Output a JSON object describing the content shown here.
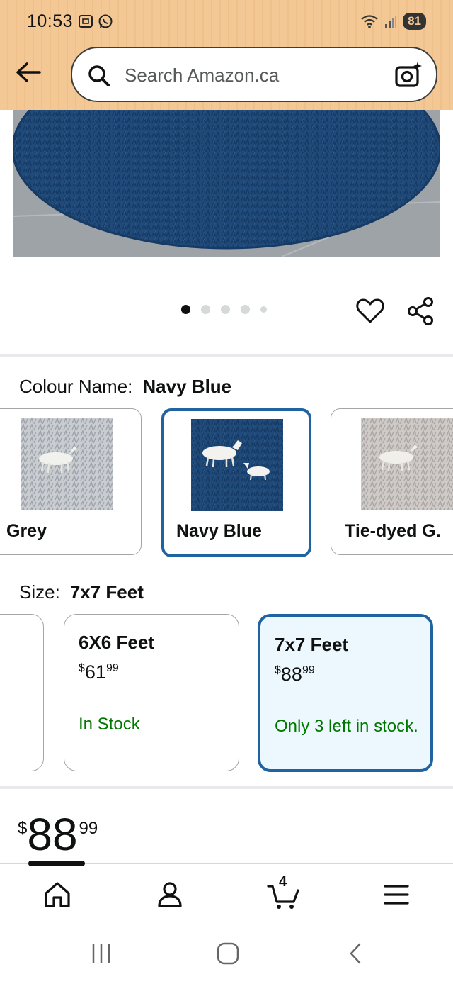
{
  "status_bar": {
    "time": "10:53",
    "battery": "81"
  },
  "search": {
    "placeholder": "Search Amazon.ca"
  },
  "carousel": {
    "dot_count": 5,
    "active_index": 0
  },
  "colour": {
    "label": "Colour Name:",
    "selected": "Navy Blue",
    "options": [
      {
        "label": "Grey"
      },
      {
        "label": "Navy Blue"
      },
      {
        "label": "Tie-dyed G."
      }
    ]
  },
  "size": {
    "label": "Size:",
    "selected": "7x7 Feet",
    "options": [
      {
        "title": "6X6 Feet",
        "currency": "$",
        "whole": "61",
        "fraction": "99",
        "stock": "In Stock"
      },
      {
        "title": "7x7 Feet",
        "currency": "$",
        "whole": "88",
        "fraction": "99",
        "stock": "Only 3 left in stock."
      }
    ]
  },
  "price": {
    "currency": "$",
    "whole": "88",
    "fraction": "99"
  },
  "bottom_nav": {
    "cart_count": "4"
  },
  "colors": {
    "header_bg": "#f3c894",
    "selected_border": "#2162a1",
    "selected_bg": "#edf8fe",
    "stock_green": "#007600",
    "rug_navy": "#1f4a7a"
  }
}
